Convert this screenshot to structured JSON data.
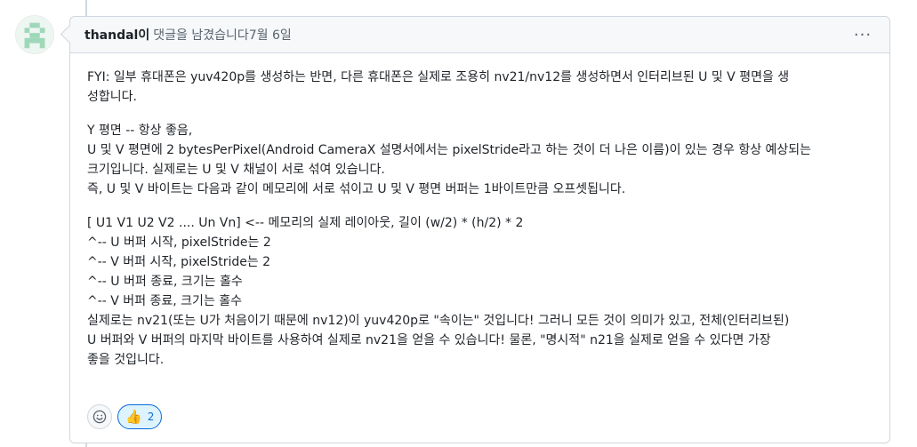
{
  "header": {
    "author": "thandal이",
    "action": "댓글을 남겼습니다",
    "date": "7월 6일",
    "menu_glyph": "···"
  },
  "body": {
    "p1": [
      "FYI: 일부 휴대폰은 yuv420p를 생성하는 반면, 다른 휴대폰은 실제로 조용히 nv21/nv12를 생성하면서 인터리브된 U 및 V 평면을 생",
      "성합니다."
    ],
    "p2": [
      "Y 평면 -- 항상 좋음,",
      "U 및 V 평면에 2 bytesPerPixel(Android CameraX 설명서에서는 pixelStride라고 하는 것이 더 나은 이름)이 있는 경우 항상 예상되는",
      "크기입니다. 실제로는 U 및 V 채널이 서로 섞여 있습니다.",
      "즉, U 및 V 바이트는 다음과 같이 메모리에 서로 섞이고 U 및 V 평면 버퍼는 1바이트만큼 오프셋됩니다."
    ],
    "p3": [
      "[ U1 V1 U2 V2 .... Un Vn] <-- 메모리의 실제 레이아웃, 길이 (w/2) * (h/2) * 2",
      "^-- U 버퍼 시작, pixelStride는 2",
      "^-- V 버퍼 시작, pixelStride는 2",
      "^-- U 버퍼 종료, 크기는 홀수",
      "^-- V 버퍼 종료, 크기는 홀수",
      "실제로는 nv21(또는 U가 처음이기 때문에 nv12)이 yuv420p로 \"속이는\" 것입니다! 그러니 모든 것이 의미가 있고, 전체(인터리브된)",
      "U 버퍼와 V 버퍼의 마지막 바이트를 사용하여 실제로 nv21을 얻을 수 있습니다! 물론, \"명시적\" n21을 실제로 얻을 수 있다면 가장",
      "좋을 것입니다."
    ]
  },
  "reactions": {
    "picker_icon": "smiley-icon",
    "thumbs_emoji": "👍",
    "thumbs_count": "2"
  },
  "colors": {
    "border": "#d0d7de",
    "header_bg": "#f6f8fa",
    "accent": "#0969da",
    "reaction_bg": "#ddf4ff"
  }
}
